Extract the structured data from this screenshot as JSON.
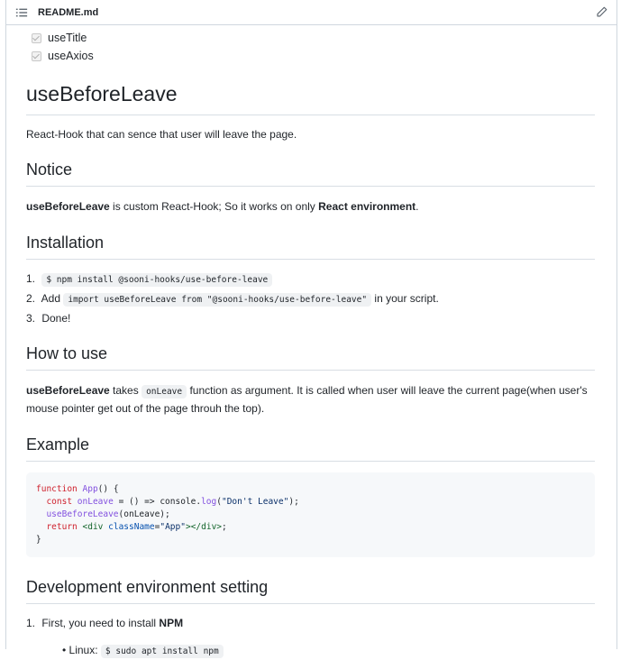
{
  "header": {
    "filename": "README.md"
  },
  "tasks": [
    "useTitle",
    "useAxios"
  ],
  "title": "useBeforeLeave",
  "intro": "React-Hook that can sence that user will leave the page.",
  "notice": {
    "heading": "Notice",
    "bold1": "useBeforeLeave",
    "text1": " is custom React-Hook; So it works on only ",
    "bold2": "React environment",
    "text2": "."
  },
  "installation": {
    "heading": "Installation",
    "steps": [
      {
        "num": "1.",
        "code": "$ npm install @sooni-hooks/use-before-leave"
      },
      {
        "num": "2.",
        "pre": "Add ",
        "code": "import useBeforeLeave from \"@sooni-hooks/use-before-leave\"",
        "post": " in your script."
      },
      {
        "num": "3.",
        "text": "Done!"
      }
    ]
  },
  "howto": {
    "heading": "How to use",
    "bold": "useBeforeLeave",
    "text1": " takes ",
    "code": "onLeave",
    "text2": " function as argument. It is called when user will leave the current page(when user's mouse pointer get out of the page throuh the top)."
  },
  "example": {
    "heading": "Example",
    "code": {
      "l1_kw": "function",
      "l1_fn": "App",
      "l1_rest": "() {",
      "l2_kw": "const",
      "l2_var": "onLeave",
      "l2_mid": " = () => console.",
      "l2_fn": "log",
      "l2_str": "\"Don't Leave\"",
      "l2_end": ");",
      "l3_fn": "useBeforeLeave",
      "l3_rest": "(onLeave);",
      "l4_kw": "return",
      "l4_open": "<div",
      "l4_attr": "className",
      "l4_str": "\"App\"",
      "l4_close": "></div>",
      "l4_end": ";",
      "l5": "}"
    }
  },
  "devenv": {
    "heading": "Development environment setting",
    "step1_num": "1.",
    "step1_text": "First, you need to install ",
    "step1_bold": "NPM",
    "sub": "Linux: ",
    "sub_code": "$ sudo apt install npm"
  }
}
